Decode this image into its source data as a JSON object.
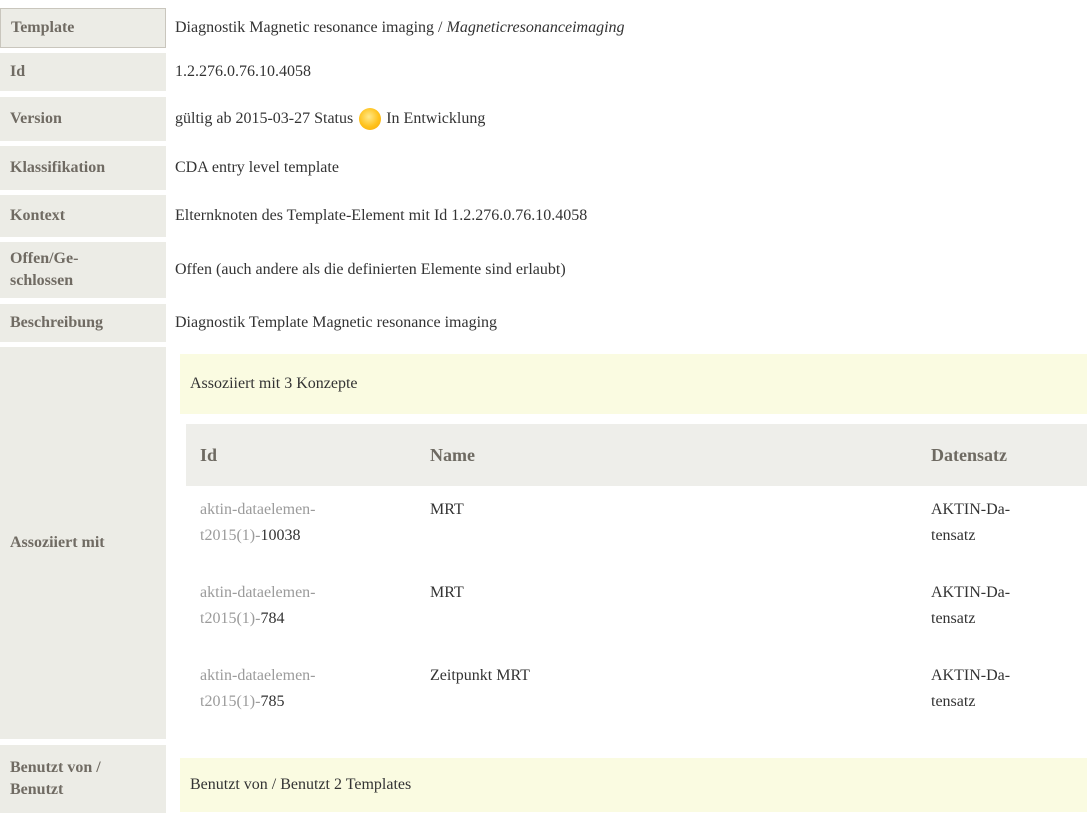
{
  "rows": {
    "template": {
      "label": "Template",
      "value": "Diagnostik Magnetic resonance imaging / ",
      "value_italic": "Magneticresonanceimaging"
    },
    "id": {
      "label": "Id",
      "value": "1.2.276.0.76.10.4058"
    },
    "version": {
      "label": "Version",
      "value_pre": "gültig ab 2015-03-27 Status",
      "status": "In Entwicklung",
      "status_color": "#ffc21c"
    },
    "klassifikation": {
      "label": "Klassifikation",
      "value": "CDA entry level template"
    },
    "kontext": {
      "label": "Kontext",
      "value": "Elternknoten des Template-Element mit Id 1.2.276.0.76.10.4058"
    },
    "offen": {
      "label_line1": "Offen/Ge-",
      "label_line2": "schlossen",
      "value": "Offen (auch andere als die definierten Elemente sind erlaubt)"
    },
    "beschreibung": {
      "label": "Beschreibung",
      "value": "Diagnostik Template Magnetic resonance imaging"
    },
    "assoziiert": {
      "label": "Assoziiert mit",
      "header": "Assoziiert mit 3 Konzepte"
    },
    "benutzt": {
      "label_line1": "Benutzt von /",
      "label_line2": "Benutzt",
      "header": "Benutzt von / Benutzt 2 Templates"
    }
  },
  "concepts_table": {
    "columns": [
      "Id",
      "Name",
      "Datensatz"
    ],
    "rows": [
      {
        "id_line1": "aktin-dataelemen-",
        "id_line2_prefix": "t2015(1)-",
        "id_num": "10038",
        "name": "MRT",
        "ds_line1": "AKTIN-Da-",
        "ds_line2": "tensatz"
      },
      {
        "id_line1": "aktin-dataelemen-",
        "id_line2_prefix": "t2015(1)-",
        "id_num": "784",
        "name": "MRT",
        "ds_line1": "AKTIN-Da-",
        "ds_line2": "tensatz"
      },
      {
        "id_line1": "aktin-dataelemen-",
        "id_line2_prefix": "t2015(1)-",
        "id_num": "785",
        "name": "Zeitpunkt MRT",
        "ds_line1": "AKTIN-Da-",
        "ds_line2": "tensatz"
      }
    ]
  }
}
